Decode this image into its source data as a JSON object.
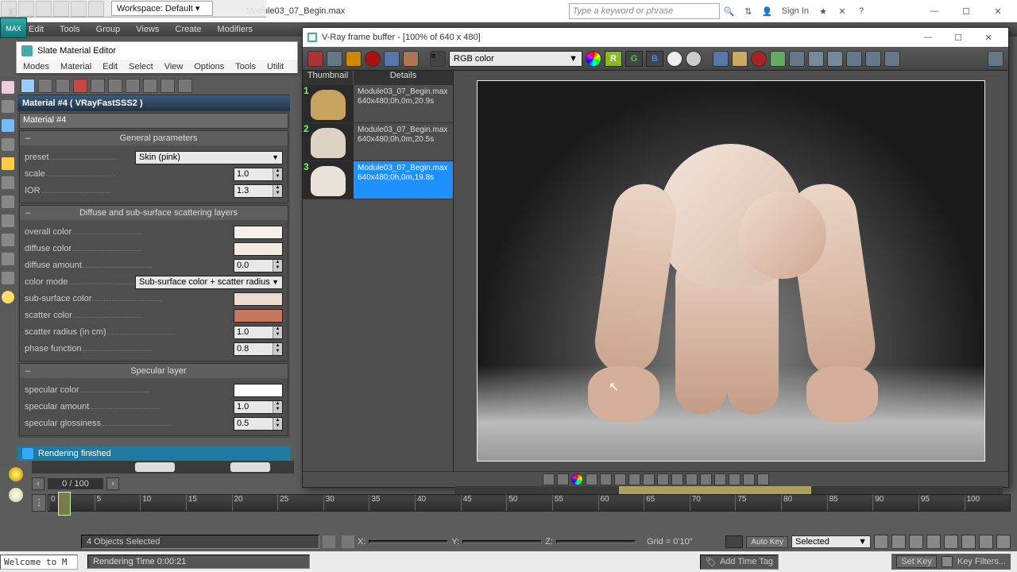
{
  "os": {
    "filename": "Module03_07_Begin.max",
    "search_placeholder": "Type a keyword or phrase",
    "signin": "Sign In",
    "workspace_label": "Workspace: Default"
  },
  "main_menu": [
    "Edit",
    "Tools",
    "Group",
    "Views",
    "Create",
    "Modifiers"
  ],
  "sme": {
    "title": "Slate Material Editor",
    "menu": [
      "Modes",
      "Material",
      "Edit",
      "Select",
      "View",
      "Options",
      "Tools",
      "Utilit"
    ]
  },
  "mat": {
    "header": "Material #4   ( VRayFastSSS2 )",
    "name": "Material #4",
    "groups": {
      "general": {
        "title": "General parameters",
        "preset_label": "preset",
        "preset_value": "Skin (pink)",
        "scale_label": "scale",
        "scale_value": "1.0",
        "ior_label": "IOR",
        "ior_value": "1.3"
      },
      "diffuse": {
        "title": "Diffuse and sub-surface scattering layers",
        "overall_color": "overall color",
        "overall_hex": "#f5f1ea",
        "diffuse_color": "diffuse color",
        "diffuse_hex": "#f3ebe0",
        "diffuse_amount": "diffuse amount",
        "diffuse_amount_val": "0.0",
        "color_mode": "color mode",
        "color_mode_val": "Sub-surface color + scatter radius",
        "sub_surface_color": "sub-surface color",
        "sub_surface_hex": "#eddad0",
        "scatter_color": "scatter color",
        "scatter_hex": "#c87760",
        "scatter_radius": "scatter radius (in cm)",
        "scatter_radius_val": "1.0",
        "phase_function": "phase function",
        "phase_function_val": "0.8"
      },
      "specular": {
        "title": "Specular layer",
        "specular_color": "specular color",
        "specular_hex": "#ffffff",
        "specular_amount": "specular amount",
        "specular_amount_val": "1.0",
        "specular_gloss": "specular glossiness",
        "specular_gloss_val": "0.5"
      }
    }
  },
  "render_status": "Rendering finished",
  "frame": {
    "current": "0 / 100"
  },
  "ruler_ticks": [
    "0",
    "5",
    "10",
    "15",
    "20",
    "25",
    "30",
    "35",
    "40",
    "45",
    "50",
    "55",
    "60",
    "65",
    "70",
    "75",
    "80",
    "85",
    "90",
    "95",
    "100"
  ],
  "status": {
    "selection": "4 Objects Selected",
    "x": "X:",
    "y": "Y:",
    "z": "Z:",
    "grid": "Grid = 0'10\"",
    "autokey": "Auto Key",
    "setkey": "Set Key",
    "selected": "Selected",
    "keyfilters": "Key Filters..."
  },
  "bottom2": {
    "welcome": "Welcome to M",
    "rendertime": "Rendering Time 0:00:21",
    "addtag": "Add Time Tag"
  },
  "vfb": {
    "title": "V-Ray frame buffer - [100% of 640 x 480]",
    "channel": "RGB color",
    "letters": [
      "R",
      "G",
      "B"
    ],
    "history_hd": {
      "thumb": "Thumbnail",
      "details": "Details"
    },
    "history": [
      {
        "n": "1",
        "file": "Module03_07_Begin.max",
        "meta": "640x480;0h,0m,20.9s",
        "tint": "#c8a360"
      },
      {
        "n": "2",
        "file": "Module03_07_Begin.max",
        "meta": "640x480;0h,0m,20.5s",
        "tint": "#ded2c4"
      },
      {
        "n": "3",
        "file": "Module03_07_Begin.max",
        "meta": "640x480;0h,0m,19.8s",
        "tint": "#e8e2da"
      }
    ],
    "selected_index": 2
  }
}
